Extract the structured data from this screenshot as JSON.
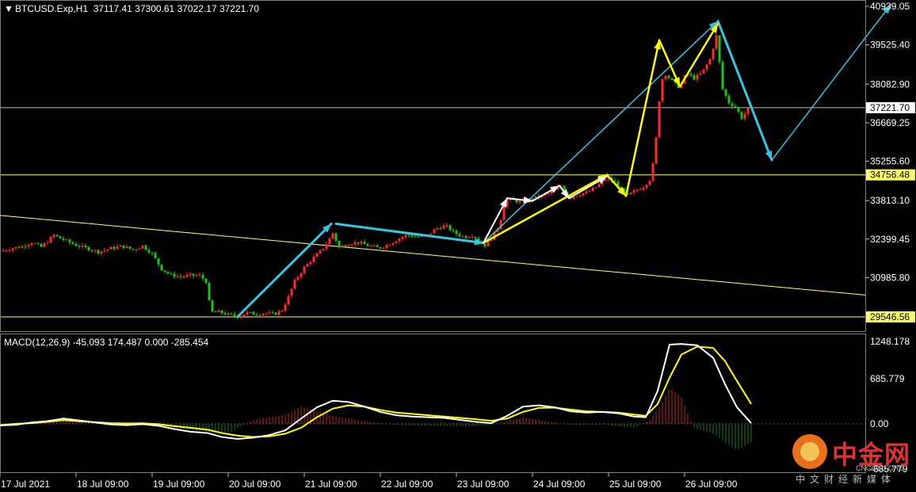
{
  "symbol_header": "BTCUSD.Exp,H1  37117.41 37300.61 37022.17 37221.70",
  "macd_header": "MACD(12,26,9) -45.093 174.487 0.000 -285.454",
  "colors": {
    "background": "#000000",
    "bull_candle": "#ff2a2a",
    "bear_candle": "#19c219",
    "price_line": "#c0c0c0",
    "support_line": "#ffff66",
    "trend_arrow": "#35c6e0",
    "wave_arrow": "#ffff00",
    "macd_main": "#ffffff",
    "macd_signal": "#ffff00"
  },
  "chart_data": [
    {
      "type": "candlestick",
      "title": "BTCUSD.Exp,H1",
      "ohlc_last": {
        "open": 37117.41,
        "high": 37300.61,
        "low": 37022.17,
        "close": 37221.7
      },
      "x_tick_labels": [
        "17 Jul 2021",
        "18 Jul 09:00",
        "19 Jul 09:00",
        "20 Jul 09:00",
        "21 Jul 09:00",
        "22 Jul 09:00",
        "23 Jul 09:00",
        "24 Jul 09:00",
        "25 Jul 09:00",
        "26 Jul 09:00"
      ],
      "y_tick_labels": [
        "40939.05",
        "39525.40",
        "38082.90",
        "36669.25",
        "35255.60",
        "33813.10",
        "32399.45",
        "30985.80"
      ],
      "ylim": [
        29546.56,
        40939.05
      ],
      "current_price": "37221.70",
      "levels": [
        {
          "label": "34756.48",
          "value": 34756.48
        },
        {
          "label": "29546.56",
          "value": 29546.56
        }
      ],
      "close_path": [
        [
          0,
          31950
        ],
        [
          14,
          32060
        ],
        [
          28,
          32130
        ],
        [
          40,
          32280
        ],
        [
          52,
          32110
        ],
        [
          60,
          32320
        ],
        [
          68,
          32540
        ],
        [
          80,
          32380
        ],
        [
          96,
          32180
        ],
        [
          110,
          32060
        ],
        [
          124,
          31930
        ],
        [
          140,
          32060
        ],
        [
          154,
          32140
        ],
        [
          168,
          32010
        ],
        [
          180,
          32150
        ],
        [
          192,
          31860
        ],
        [
          204,
          31300
        ],
        [
          216,
          31080
        ],
        [
          228,
          31020
        ],
        [
          240,
          31070
        ],
        [
          252,
          31060
        ],
        [
          260,
          30850
        ],
        [
          266,
          29720
        ],
        [
          276,
          29730
        ],
        [
          288,
          29630
        ],
        [
          300,
          29560
        ],
        [
          312,
          29700
        ],
        [
          322,
          29650
        ],
        [
          334,
          29690
        ],
        [
          346,
          29640
        ],
        [
          356,
          29800
        ],
        [
          364,
          30280
        ],
        [
          372,
          30860
        ],
        [
          384,
          31360
        ],
        [
          396,
          31720
        ],
        [
          406,
          32000
        ],
        [
          414,
          32300
        ],
        [
          420,
          32620
        ],
        [
          428,
          32100
        ],
        [
          440,
          32230
        ],
        [
          452,
          32280
        ],
        [
          466,
          32150
        ],
        [
          478,
          32070
        ],
        [
          490,
          32200
        ],
        [
          502,
          32400
        ],
        [
          514,
          32560
        ],
        [
          526,
          32480
        ],
        [
          538,
          32500
        ],
        [
          550,
          32780
        ],
        [
          562,
          32900
        ],
        [
          574,
          32620
        ],
        [
          586,
          32480
        ],
        [
          598,
          32550
        ],
        [
          604,
          32300
        ],
        [
          612,
          32180
        ],
        [
          620,
          32420
        ],
        [
          630,
          32900
        ],
        [
          638,
          33880
        ],
        [
          650,
          33800
        ],
        [
          662,
          33760
        ],
        [
          672,
          33900
        ],
        [
          684,
          33980
        ],
        [
          696,
          34120
        ],
        [
          708,
          34350
        ],
        [
          718,
          33910
        ],
        [
          730,
          34040
        ],
        [
          742,
          34120
        ],
        [
          754,
          34350
        ],
        [
          766,
          34650
        ],
        [
          778,
          34450
        ],
        [
          790,
          33960
        ],
        [
          800,
          34140
        ],
        [
          812,
          34330
        ],
        [
          822,
          34640
        ],
        [
          828,
          36100
        ],
        [
          834,
          38200
        ],
        [
          840,
          38450
        ],
        [
          848,
          38200
        ],
        [
          858,
          37950
        ],
        [
          866,
          38500
        ],
        [
          876,
          38300
        ],
        [
          886,
          38500
        ],
        [
          896,
          39000
        ],
        [
          904,
          39850
        ],
        [
          912,
          37900
        ],
        [
          920,
          37400
        ],
        [
          928,
          37250
        ],
        [
          936,
          36850
        ],
        [
          946,
          37221.7
        ]
      ],
      "trend_arrows": [
        {
          "from": [
            300,
            29560
          ],
          "to": [
            418,
            32960
          ]
        },
        {
          "from": [
            424,
            32960
          ],
          "to": [
            610,
            32260
          ]
        },
        {
          "from": [
            610,
            32260
          ],
          "to": [
            906,
            40400
          ]
        },
        {
          "from": [
            906,
            40400
          ],
          "to": [
            974,
            35300
          ]
        },
        {
          "from": [
            974,
            35300
          ],
          "to": [
            1124,
            41000
          ]
        }
      ],
      "wave_arrows": [
        {
          "from": [
            610,
            32260
          ],
          "to": [
            766,
            34760
          ],
          "color": "yellow"
        },
        {
          "from": [
            766,
            34760
          ],
          "to": [
            790,
            33980
          ],
          "color": "yellow"
        },
        {
          "from": [
            790,
            33980
          ],
          "to": [
            832,
            39700
          ],
          "color": "yellow"
        },
        {
          "from": [
            832,
            39700
          ],
          "to": [
            858,
            38000
          ],
          "color": "yellow"
        },
        {
          "from": [
            858,
            38000
          ],
          "to": [
            906,
            40300
          ],
          "color": "yellow"
        },
        {
          "from": [
            610,
            32260
          ],
          "to": [
            640,
            33900
          ],
          "color": "white"
        },
        {
          "from": [
            640,
            33900
          ],
          "to": [
            672,
            33800
          ],
          "color": "white"
        },
        {
          "from": [
            672,
            33800
          ],
          "to": [
            706,
            34360
          ],
          "color": "white"
        },
        {
          "from": [
            706,
            34360
          ],
          "to": [
            718,
            33900
          ],
          "color": "white"
        },
        {
          "from": [
            718,
            33900
          ],
          "to": [
            766,
            34700
          ],
          "color": "white"
        }
      ],
      "descending_line": {
        "from": [
          0,
          33270
        ],
        "to": [
          1092,
          30350
        ]
      }
    },
    {
      "type": "line",
      "title": "MACD(12,26,9)",
      "values": {
        "main": -45.093,
        "signal": 174.487,
        "level": 0.0,
        "histogram": -285.454
      },
      "y_tick_labels": [
        "1248.178",
        "685.779",
        "0.00",
        "-685.779"
      ],
      "ylim": [
        -685.779,
        1248.178
      ],
      "series": [
        {
          "name": "main",
          "points": [
            [
              0,
              -25
            ],
            [
              20,
              -15
            ],
            [
              40,
              20
            ],
            [
              60,
              40
            ],
            [
              80,
              80
            ],
            [
              100,
              50
            ],
            [
              120,
              20
            ],
            [
              140,
              -10
            ],
            [
              160,
              -20
            ],
            [
              180,
              -5
            ],
            [
              200,
              -30
            ],
            [
              220,
              -80
            ],
            [
              240,
              -120
            ],
            [
              262,
              -140
            ],
            [
              280,
              -200
            ],
            [
              300,
              -230
            ],
            [
              320,
              -210
            ],
            [
              340,
              -170
            ],
            [
              360,
              -100
            ],
            [
              380,
              80
            ],
            [
              400,
              250
            ],
            [
              420,
              350
            ],
            [
              440,
              330
            ],
            [
              460,
              260
            ],
            [
              480,
              180
            ],
            [
              500,
              130
            ],
            [
              520,
              110
            ],
            [
              540,
              100
            ],
            [
              560,
              90
            ],
            [
              580,
              60
            ],
            [
              600,
              30
            ],
            [
              620,
              10
            ],
            [
              640,
              120
            ],
            [
              660,
              260
            ],
            [
              680,
              280
            ],
            [
              700,
              250
            ],
            [
              720,
              190
            ],
            [
              740,
              170
            ],
            [
              760,
              180
            ],
            [
              780,
              160
            ],
            [
              800,
              110
            ],
            [
              815,
              100
            ],
            [
              830,
              500
            ],
            [
              845,
              1200
            ],
            [
              860,
              1210
            ],
            [
              880,
              1190
            ],
            [
              900,
              1000
            ],
            [
              915,
              600
            ],
            [
              930,
              250
            ],
            [
              948,
              10
            ]
          ]
        },
        {
          "name": "signal",
          "points": [
            [
              0,
              -20
            ],
            [
              20,
              0
            ],
            [
              40,
              10
            ],
            [
              60,
              30
            ],
            [
              80,
              55
            ],
            [
              100,
              40
            ],
            [
              120,
              25
            ],
            [
              140,
              10
            ],
            [
              160,
              5
            ],
            [
              180,
              8
            ],
            [
              200,
              -5
            ],
            [
              220,
              -35
            ],
            [
              240,
              -60
            ],
            [
              262,
              -90
            ],
            [
              280,
              -140
            ],
            [
              300,
              -180
            ],
            [
              320,
              -200
            ],
            [
              340,
              -190
            ],
            [
              360,
              -150
            ],
            [
              380,
              -60
            ],
            [
              400,
              100
            ],
            [
              420,
              230
            ],
            [
              440,
              280
            ],
            [
              460,
              260
            ],
            [
              480,
              210
            ],
            [
              500,
              170
            ],
            [
              520,
              150
            ],
            [
              540,
              130
            ],
            [
              560,
              110
            ],
            [
              580,
              90
            ],
            [
              600,
              70
            ],
            [
              620,
              45
            ],
            [
              640,
              80
            ],
            [
              660,
              180
            ],
            [
              680,
              240
            ],
            [
              700,
              245
            ],
            [
              720,
              215
            ],
            [
              740,
              190
            ],
            [
              760,
              180
            ],
            [
              780,
              170
            ],
            [
              800,
              140
            ],
            [
              815,
              120
            ],
            [
              830,
              300
            ],
            [
              845,
              700
            ],
            [
              860,
              1050
            ],
            [
              880,
              1170
            ],
            [
              900,
              1150
            ],
            [
              915,
              950
            ],
            [
              930,
              650
            ],
            [
              948,
              300
            ]
          ]
        },
        {
          "name": "histogram",
          "points": [
            [
              0,
              -40
            ],
            [
              40,
              20
            ],
            [
              80,
              60
            ],
            [
              100,
              30
            ],
            [
              140,
              -20
            ],
            [
              180,
              0
            ],
            [
              220,
              -60
            ],
            [
              260,
              -120
            ],
            [
              290,
              -130
            ],
            [
              320,
              60
            ],
            [
              360,
              140
            ],
            [
              380,
              260
            ],
            [
              400,
              200
            ],
            [
              420,
              120
            ],
            [
              460,
              40
            ],
            [
              500,
              -20
            ],
            [
              540,
              -30
            ],
            [
              580,
              -40
            ],
            [
              620,
              -20
            ],
            [
              640,
              40
            ],
            [
              660,
              100
            ],
            [
              690,
              40
            ],
            [
              720,
              -20
            ],
            [
              760,
              -10
            ],
            [
              800,
              -60
            ],
            [
              820,
              60
            ],
            [
              835,
              300
            ],
            [
              845,
              550
            ],
            [
              860,
              400
            ],
            [
              875,
              -60
            ],
            [
              900,
              -150
            ],
            [
              915,
              -280
            ],
            [
              930,
              -400
            ],
            [
              948,
              -285
            ]
          ]
        }
      ]
    }
  ],
  "watermark": {
    "title": "中金网",
    "sub1": "CNGOLD.ORG",
    "sub2": "中文财经新媒体"
  }
}
